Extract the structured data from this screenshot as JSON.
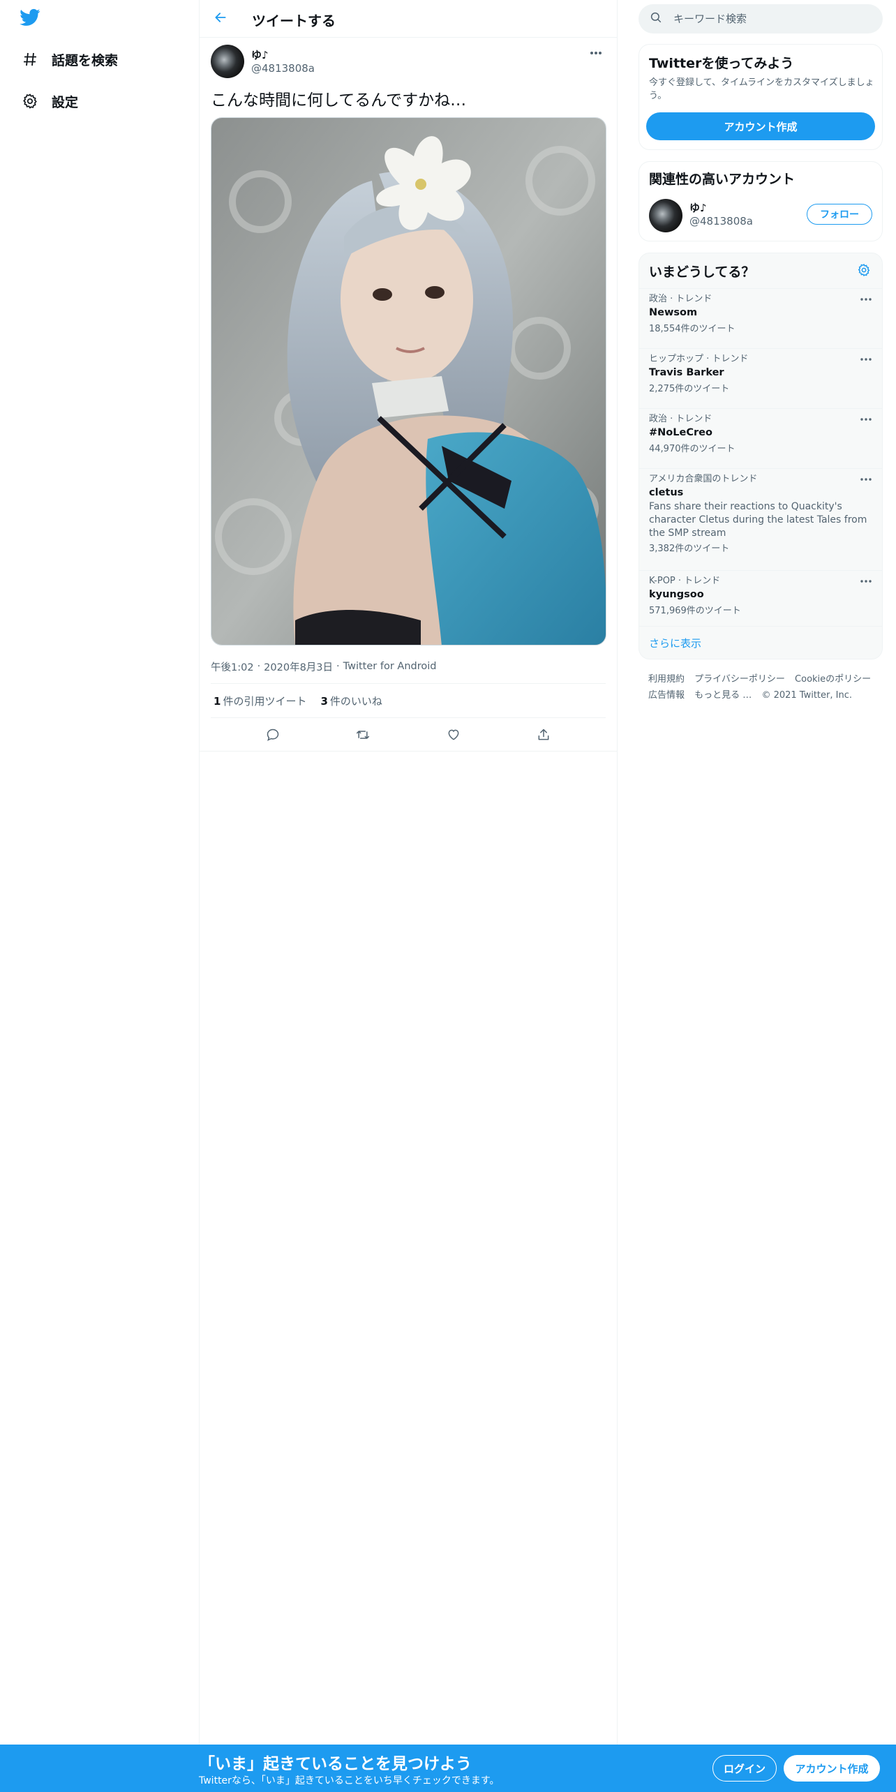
{
  "colors": {
    "brand": "#1d9bf0",
    "text": "#0f1419",
    "secondary": "#536471",
    "border": "#eff3f4"
  },
  "nav": {
    "logo_icon": "twitter-bird-icon",
    "items": [
      {
        "label": "話題を検索",
        "icon": "hashtag-icon"
      },
      {
        "label": "設定",
        "icon": "gear-icon"
      }
    ]
  },
  "header": {
    "title": "ツイートする",
    "back_icon": "arrow-left-icon"
  },
  "tweet": {
    "author_name": "ゆ♪",
    "author_handle": "@4813808a",
    "text": "こんな時間に何してるんですかね…",
    "time": "午後1:02",
    "date": "2020年8月3日",
    "source": "Twitter for Android",
    "separator": "·",
    "quote_count": "1",
    "quote_label": "件の引用ツイート",
    "like_count": "3",
    "like_label": "件のいいね",
    "actions": [
      "reply-icon",
      "retweet-icon",
      "like-icon",
      "share-icon"
    ]
  },
  "search": {
    "placeholder": "キーワード検索"
  },
  "signup_card": {
    "title": "Twitterを使ってみよう",
    "description": "今すぐ登録して、タイムラインをカスタマイズしましょう。",
    "button": "アカウント作成"
  },
  "related": {
    "title": "関連性の高いアカウント",
    "name": "ゆ♪",
    "handle": "@4813808a",
    "follow_label": "フォロー"
  },
  "trends": {
    "title": "いまどうしてる？",
    "items": [
      {
        "category": "政治 · トレンド",
        "name": "Newsom",
        "description": "",
        "count": "18,554件のツイート"
      },
      {
        "category": "ヒップホップ · トレンド",
        "name": "Travis Barker",
        "description": "",
        "count": "2,275件のツイート"
      },
      {
        "category": "政治 · トレンド",
        "name": "#NoLeCreo",
        "description": "",
        "count": "44,970件のツイート"
      },
      {
        "category": "アメリカ合衆国のトレンド",
        "name": "cletus",
        "description": "Fans share their reactions to Quackity's character Cletus during the latest Tales from the SMP stream",
        "count": "3,382件のツイート"
      },
      {
        "category": "K-POP · トレンド",
        "name": "kyungsoo",
        "description": "",
        "count": "571,969件のツイート"
      }
    ],
    "show_more": "さらに表示"
  },
  "footer": {
    "links": [
      "利用規約",
      "プライバシーポリシー",
      "Cookieのポリシー",
      "広告情報",
      "もっと見る …"
    ],
    "copyright": "© 2021 Twitter, Inc."
  },
  "bottom_bar": {
    "title": "「いま」起きていることを見つけよう",
    "subtitle": "Twitterなら、「いま」起きていることをいち早くチェックできます。",
    "login": "ログイン",
    "signup": "アカウント作成"
  }
}
